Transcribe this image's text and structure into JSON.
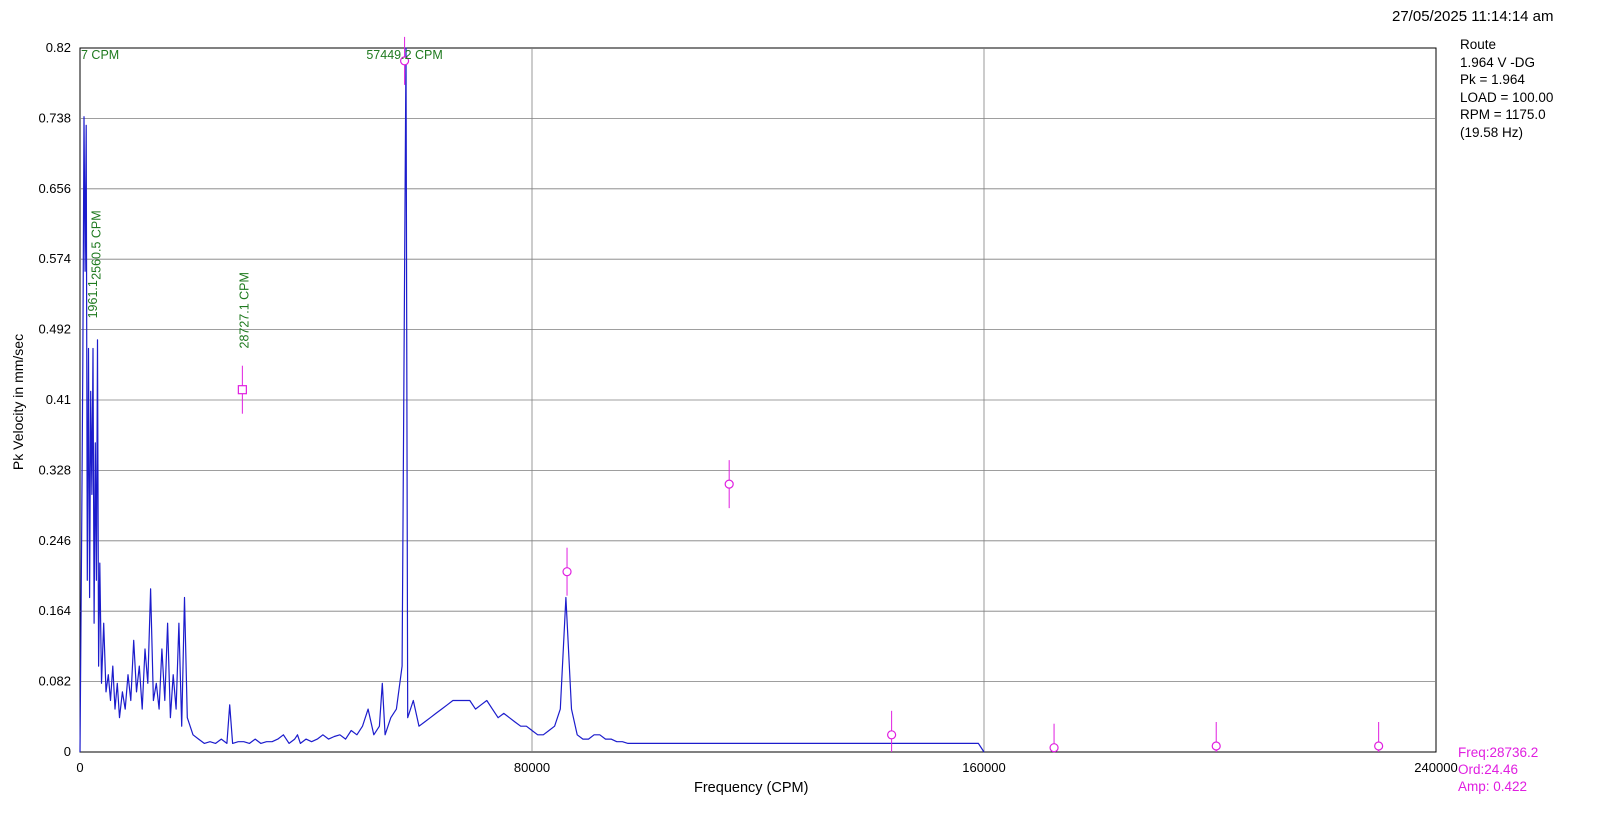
{
  "header": {
    "timestamp": "27/05/2025 11:14:14 am"
  },
  "info_panel": {
    "lines": [
      "Route",
      "1.964 V -DG",
      "Pk = 1.964",
      "LOAD = 100.00",
      "RPM = 1175.0",
      "(19.58 Hz)"
    ]
  },
  "cursor_readout": {
    "freq": "Freq:28736.2",
    "ord": "Ord:24.46",
    "amp": "Amp: 0.422"
  },
  "colors": {
    "spectrum": "#1c1ccc",
    "marker": "#e01ee0",
    "label": "#1f7a1f",
    "grid": "#7f7f7f"
  },
  "chart_data": {
    "type": "line",
    "xlabel": "Frequency (CPM)",
    "ylabel": "Pk Velocity in mm/sec",
    "xlim": [
      0,
      240000
    ],
    "ylim": [
      0,
      0.82
    ],
    "x_ticks": [
      0,
      80000,
      160000,
      240000
    ],
    "x_tick_labels": [
      "0",
      "80000",
      "160000",
      "240000"
    ],
    "y_ticks": [
      0,
      0.082,
      0.164,
      0.246,
      0.328,
      0.41,
      0.492,
      0.574,
      0.656,
      0.738,
      0.82
    ],
    "y_tick_labels": [
      "0",
      "0.082",
      "0.164",
      "0.246",
      "0.328",
      "0.41",
      "0.492",
      "0.574",
      "0.656",
      "0.738",
      "0.82"
    ],
    "grid": true,
    "series": [
      {
        "points": [
          [
            0,
            0.0
          ],
          [
            300,
            0.26
          ],
          [
            500,
            0.45
          ],
          [
            700,
            0.74
          ],
          [
            900,
            0.56
          ],
          [
            1100,
            0.73
          ],
          [
            1300,
            0.2
          ],
          [
            1500,
            0.47
          ],
          [
            1700,
            0.18
          ],
          [
            1900,
            0.42
          ],
          [
            2100,
            0.3
          ],
          [
            2300,
            0.47
          ],
          [
            2500,
            0.15
          ],
          [
            2700,
            0.36
          ],
          [
            2900,
            0.2
          ],
          [
            3100,
            0.48
          ],
          [
            3300,
            0.1
          ],
          [
            3500,
            0.22
          ],
          [
            3800,
            0.08
          ],
          [
            4200,
            0.15
          ],
          [
            4600,
            0.07
          ],
          [
            5000,
            0.09
          ],
          [
            5400,
            0.06
          ],
          [
            5800,
            0.1
          ],
          [
            6200,
            0.05
          ],
          [
            6600,
            0.08
          ],
          [
            7000,
            0.04
          ],
          [
            7500,
            0.07
          ],
          [
            8000,
            0.05
          ],
          [
            8500,
            0.09
          ],
          [
            9000,
            0.06
          ],
          [
            9500,
            0.13
          ],
          [
            10000,
            0.07
          ],
          [
            10500,
            0.1
          ],
          [
            11000,
            0.05
          ],
          [
            11500,
            0.12
          ],
          [
            12000,
            0.08
          ],
          [
            12500,
            0.19
          ],
          [
            13000,
            0.06
          ],
          [
            13500,
            0.08
          ],
          [
            14000,
            0.05
          ],
          [
            14500,
            0.12
          ],
          [
            15000,
            0.06
          ],
          [
            15500,
            0.15
          ],
          [
            16000,
            0.04
          ],
          [
            16500,
            0.09
          ],
          [
            17000,
            0.05
          ],
          [
            17500,
            0.15
          ],
          [
            18000,
            0.03
          ],
          [
            18500,
            0.18
          ],
          [
            19000,
            0.04
          ],
          [
            20000,
            0.02
          ],
          [
            21000,
            0.015
          ],
          [
            22000,
            0.01
          ],
          [
            23000,
            0.012
          ],
          [
            24000,
            0.01
          ],
          [
            25000,
            0.015
          ],
          [
            26000,
            0.01
          ],
          [
            26500,
            0.055
          ],
          [
            27000,
            0.01
          ],
          [
            28000,
            0.012
          ],
          [
            29000,
            0.012
          ],
          [
            30000,
            0.01
          ],
          [
            31000,
            0.015
          ],
          [
            32000,
            0.01
          ],
          [
            33000,
            0.012
          ],
          [
            34000,
            0.012
          ],
          [
            35000,
            0.015
          ],
          [
            36000,
            0.02
          ],
          [
            37000,
            0.01
          ],
          [
            38000,
            0.015
          ],
          [
            38500,
            0.02
          ],
          [
            39000,
            0.01
          ],
          [
            40000,
            0.015
          ],
          [
            41000,
            0.012
          ],
          [
            42000,
            0.015
          ],
          [
            43000,
            0.02
          ],
          [
            44000,
            0.015
          ],
          [
            45000,
            0.018
          ],
          [
            46000,
            0.02
          ],
          [
            47000,
            0.015
          ],
          [
            48000,
            0.025
          ],
          [
            49000,
            0.02
          ],
          [
            50000,
            0.03
          ],
          [
            51000,
            0.05
          ],
          [
            52000,
            0.02
          ],
          [
            53000,
            0.03
          ],
          [
            53500,
            0.08
          ],
          [
            54000,
            0.02
          ],
          [
            55000,
            0.04
          ],
          [
            56000,
            0.05
          ],
          [
            57000,
            0.1
          ],
          [
            57700,
            0.82
          ],
          [
            58000,
            0.04
          ],
          [
            59000,
            0.06
          ],
          [
            60000,
            0.03
          ],
          [
            61000,
            0.035
          ],
          [
            62000,
            0.04
          ],
          [
            63000,
            0.045
          ],
          [
            64000,
            0.05
          ],
          [
            65000,
            0.055
          ],
          [
            66000,
            0.06
          ],
          [
            67000,
            0.06
          ],
          [
            68000,
            0.06
          ],
          [
            69000,
            0.06
          ],
          [
            70000,
            0.05
          ],
          [
            71000,
            0.055
          ],
          [
            72000,
            0.06
          ],
          [
            73000,
            0.05
          ],
          [
            74000,
            0.04
          ],
          [
            75000,
            0.045
          ],
          [
            76000,
            0.04
          ],
          [
            77000,
            0.035
          ],
          [
            78000,
            0.03
          ],
          [
            79000,
            0.03
          ],
          [
            80000,
            0.025
          ],
          [
            81000,
            0.02
          ],
          [
            82000,
            0.02
          ],
          [
            83000,
            0.025
          ],
          [
            84000,
            0.03
          ],
          [
            85000,
            0.05
          ],
          [
            86000,
            0.18
          ],
          [
            87000,
            0.05
          ],
          [
            88000,
            0.02
          ],
          [
            89000,
            0.015
          ],
          [
            90000,
            0.015
          ],
          [
            91000,
            0.02
          ],
          [
            92000,
            0.02
          ],
          [
            93000,
            0.015
          ],
          [
            94000,
            0.015
          ],
          [
            95000,
            0.012
          ],
          [
            96000,
            0.012
          ],
          [
            97000,
            0.01
          ],
          [
            98000,
            0.01
          ],
          [
            99000,
            0.01
          ],
          [
            100000,
            0.01
          ],
          [
            101000,
            0.01
          ],
          [
            102000,
            0.01
          ],
          [
            103000,
            0.01
          ],
          [
            104000,
            0.01
          ],
          [
            105000,
            0.01
          ],
          [
            106000,
            0.01
          ],
          [
            107000,
            0.01
          ],
          [
            108000,
            0.01
          ],
          [
            109000,
            0.01
          ],
          [
            110000,
            0.01
          ],
          [
            111000,
            0.01
          ],
          [
            112000,
            0.01
          ],
          [
            113000,
            0.01
          ],
          [
            114000,
            0.01
          ],
          [
            115000,
            0.01
          ],
          [
            116000,
            0.01
          ],
          [
            117000,
            0.01
          ],
          [
            118000,
            0.01
          ],
          [
            119000,
            0.01
          ],
          [
            120000,
            0.01
          ],
          [
            121000,
            0.01
          ],
          [
            122000,
            0.01
          ],
          [
            123000,
            0.01
          ],
          [
            124000,
            0.01
          ],
          [
            125000,
            0.01
          ],
          [
            126000,
            0.01
          ],
          [
            127000,
            0.01
          ],
          [
            128000,
            0.01
          ],
          [
            129000,
            0.01
          ],
          [
            130000,
            0.01
          ],
          [
            131000,
            0.01
          ],
          [
            132000,
            0.01
          ],
          [
            133000,
            0.01
          ],
          [
            134000,
            0.01
          ],
          [
            135000,
            0.01
          ],
          [
            136000,
            0.01
          ],
          [
            137000,
            0.01
          ],
          [
            138000,
            0.01
          ],
          [
            139000,
            0.01
          ],
          [
            140000,
            0.01
          ],
          [
            141000,
            0.01
          ],
          [
            142000,
            0.01
          ],
          [
            143000,
            0.01
          ],
          [
            144000,
            0.01
          ],
          [
            145000,
            0.01
          ],
          [
            146000,
            0.01
          ],
          [
            147000,
            0.01
          ],
          [
            148000,
            0.01
          ],
          [
            149000,
            0.01
          ],
          [
            150000,
            0.01
          ],
          [
            151000,
            0.01
          ],
          [
            152000,
            0.01
          ],
          [
            153000,
            0.01
          ],
          [
            154000,
            0.01
          ],
          [
            155000,
            0.01
          ],
          [
            156000,
            0.01
          ],
          [
            157000,
            0.01
          ],
          [
            158000,
            0.01
          ],
          [
            159000,
            0.01
          ],
          [
            160000,
            0.0
          ]
        ]
      }
    ],
    "markers": [
      {
        "shape": "square",
        "x": 28736.2,
        "y": 0.422
      },
      {
        "shape": "circle",
        "x": 57449.2,
        "y": 0.805
      },
      {
        "shape": "circle",
        "x": 86200,
        "y": 0.21
      },
      {
        "shape": "circle",
        "x": 114900,
        "y": 0.312
      },
      {
        "shape": "circle",
        "x": 143650,
        "y": 0.02
      },
      {
        "shape": "circle",
        "x": 172400,
        "y": 0.005
      },
      {
        "shape": "circle",
        "x": 201100,
        "y": 0.007
      },
      {
        "shape": "circle",
        "x": 229850,
        "y": 0.007
      }
    ],
    "peak_labels": [
      {
        "text": "7 CPM",
        "x": 0,
        "y": 0.82,
        "rotated": false
      },
      {
        "text": "57449.2 CPM",
        "x": 57449.2,
        "y": 0.82,
        "rotated": false
      },
      {
        "text": "2560.5 CPM",
        "x": 2560.5,
        "y": 0.55,
        "rotated": true
      },
      {
        "text": "1961.1",
        "x": 1961.1,
        "y": 0.505,
        "rotated": true
      },
      {
        "text": "28727.1 CPM",
        "x": 28727.1,
        "y": 0.47,
        "rotated": true
      }
    ]
  }
}
